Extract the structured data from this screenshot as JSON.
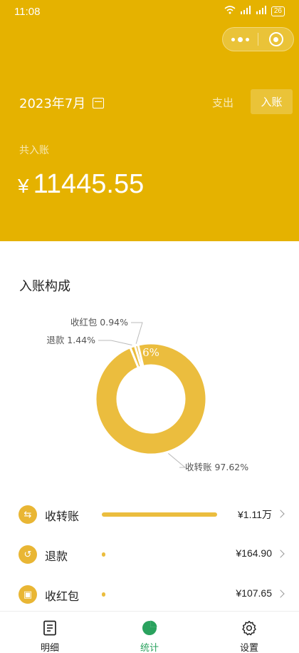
{
  "status_bar": {
    "time": "11:08",
    "battery": "26"
  },
  "header": {
    "date": "2023年7月",
    "type_expense": "支出",
    "type_income": "入账",
    "total_label": "共入账",
    "currency": "¥",
    "total_amount": "11445.55"
  },
  "composition": {
    "title": "入账构成",
    "chart_data": {
      "type": "pie",
      "style": "donut",
      "labels": [
        "收转账",
        "退款",
        "收红包"
      ],
      "values": [
        97.62,
        1.44,
        0.94
      ],
      "slice_labels": [
        "收转账 97.62%",
        "退款 1.44%",
        "收红包 0.94%"
      ],
      "overlay_label": "6%",
      "color": "#ebbd3e"
    }
  },
  "list": [
    {
      "label": "收转账",
      "value": "¥1.11万",
      "fraction": 1.0,
      "icon": "transfer-icon",
      "glyph": "⇆"
    },
    {
      "label": "退款",
      "value": "¥164.90",
      "fraction": 0.0148,
      "icon": "refund-icon",
      "glyph": "↺"
    },
    {
      "label": "收红包",
      "value": "¥107.65",
      "fraction": 0.0097,
      "icon": "red-packet-icon",
      "glyph": "▣"
    }
  ],
  "tabbar": {
    "tabs": [
      {
        "label": "明细",
        "icon": "document-icon"
      },
      {
        "label": "统计",
        "icon": "pie-chart-icon",
        "active": true
      },
      {
        "label": "设置",
        "icon": "gear-icon"
      }
    ]
  },
  "colors": {
    "brand": "#e5b200",
    "chart": "#ebbd3e",
    "active_tab": "#2aa25e"
  }
}
